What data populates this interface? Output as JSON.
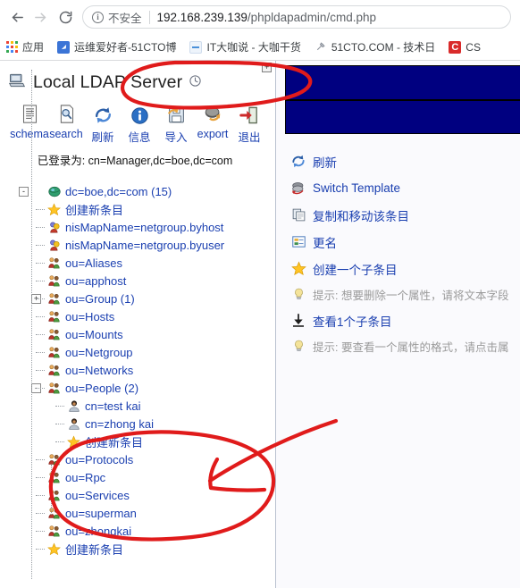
{
  "browser": {
    "back_icon": "back-arrow-icon",
    "forward_icon": "forward-arrow-icon",
    "reload_icon": "reload-icon",
    "security_label": "不安全",
    "url_host": "192.168.239.139",
    "url_path": "/phpldapadmin/cmd.php",
    "url_full": "192.168.239.139/phpldapadmin/cmd.php",
    "bookmarks": [
      {
        "label": "应用",
        "icon": "apps-grid-icon",
        "color": "#4285f4"
      },
      {
        "label": "运维爱好者-51CTO博",
        "icon": "bookmark-icon",
        "color": "#3b74d6"
      },
      {
        "label": "IT大咖说 - 大咖干货",
        "icon": "bookmark-icon",
        "color": "#7fb3e8"
      },
      {
        "label": "51CTO.COM - 技术日",
        "icon": "bookmark-icon",
        "color": "#9aa0a6"
      },
      {
        "label": "CS",
        "icon": "bookmark-icon",
        "color": "#d92b2b"
      }
    ]
  },
  "left_panel": {
    "expand_box_label": "+",
    "server_title": "Local LDAP Server",
    "server_icon": "computer-icon",
    "clock_icon": "clock-icon",
    "toolbar": [
      {
        "label": "schema",
        "icon": "schema-icon"
      },
      {
        "label": "search",
        "icon": "search-icon"
      },
      {
        "label": "刷新",
        "icon": "refresh-icon"
      },
      {
        "label": "信息",
        "icon": "info-icon"
      },
      {
        "label": "导入",
        "icon": "import-icon"
      },
      {
        "label": "export",
        "icon": "export-icon"
      },
      {
        "label": "退出",
        "icon": "logout-icon"
      }
    ],
    "logged_in_text": "已登录为: cn=Manager,dc=boe,dc=com",
    "tree": [
      {
        "label": "dc=boe,dc=com (15)",
        "icon": "globe-icon",
        "toggle": "-",
        "level": 0
      },
      {
        "label": "创建新条目",
        "icon": "star-icon",
        "toggle": "",
        "level": 1
      },
      {
        "label": "nisMapName=netgroup.byhost",
        "icon": "map-icon",
        "toggle": "",
        "level": 1
      },
      {
        "label": "nisMapName=netgroup.byuser",
        "icon": "map-icon",
        "toggle": "",
        "level": 1
      },
      {
        "label": "ou=Aliases",
        "icon": "ou-icon",
        "toggle": "",
        "level": 1
      },
      {
        "label": "ou=apphost",
        "icon": "ou-icon",
        "toggle": "",
        "level": 1
      },
      {
        "label": "ou=Group (1)",
        "icon": "ou-icon",
        "toggle": "+",
        "level": 1
      },
      {
        "label": "ou=Hosts",
        "icon": "ou-icon",
        "toggle": "",
        "level": 1
      },
      {
        "label": "ou=Mounts",
        "icon": "ou-icon",
        "toggle": "",
        "level": 1
      },
      {
        "label": "ou=Netgroup",
        "icon": "ou-icon",
        "toggle": "",
        "level": 1
      },
      {
        "label": "ou=Networks",
        "icon": "ou-icon",
        "toggle": "",
        "level": 1
      },
      {
        "label": "ou=People (2)",
        "icon": "ou-icon",
        "toggle": "-",
        "level": 1
      },
      {
        "label": "cn=test kai",
        "icon": "person-icon",
        "toggle": "",
        "level": 2
      },
      {
        "label": "cn=zhong kai",
        "icon": "person-icon",
        "toggle": "",
        "level": 2
      },
      {
        "label": "创建新条目",
        "icon": "star-icon",
        "toggle": "",
        "level": 2
      },
      {
        "label": "ou=Protocols",
        "icon": "ou-icon",
        "toggle": "",
        "level": 1
      },
      {
        "label": "ou=Rpc",
        "icon": "ou-icon",
        "toggle": "",
        "level": 1
      },
      {
        "label": "ou=Services",
        "icon": "ou-icon",
        "toggle": "",
        "level": 1
      },
      {
        "label": "ou=superman",
        "icon": "ou-icon",
        "toggle": "",
        "level": 1
      },
      {
        "label": "ou=zhongkai",
        "icon": "ou-icon",
        "toggle": "",
        "level": 1
      },
      {
        "label": "创建新条目",
        "icon": "star-icon",
        "toggle": "",
        "level": 1
      }
    ]
  },
  "right_panel": {
    "banner_color": "#000080",
    "actions": [
      {
        "label": "刷新",
        "icon": "refresh-icon",
        "kind": "link"
      },
      {
        "label": "Switch Template",
        "icon": "template-icon",
        "kind": "link"
      },
      {
        "label": "复制和移动该条目",
        "icon": "copy-icon",
        "kind": "link"
      },
      {
        "label": "更名",
        "icon": "rename-icon",
        "kind": "link"
      },
      {
        "label": "创建一个子条目",
        "icon": "star-icon",
        "kind": "link"
      },
      {
        "label": "提示: 想要删除一个属性，请将文本字段",
        "icon": "bulb-icon",
        "kind": "hint"
      },
      {
        "label": "查看1个子条目",
        "icon": "download-icon",
        "kind": "link"
      },
      {
        "label": "提示: 要查看一个属性的格式，请点击属",
        "icon": "bulb-icon",
        "kind": "hint"
      }
    ]
  },
  "annotations": {
    "color": "#e01b1b",
    "url_circle": "hand-drawn-ellipse-around-url",
    "people_circle": "hand-drawn-ellipse-around-people-subtree",
    "arrow": "hand-drawn-arrow-to-cn-zhong-kai"
  }
}
